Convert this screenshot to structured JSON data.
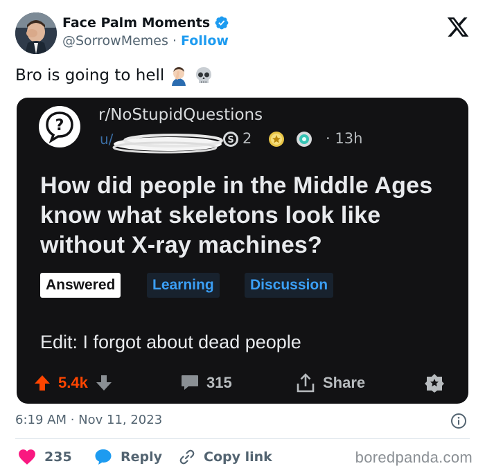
{
  "tweet": {
    "author_name": "Face Palm Moments",
    "author_handle": "@SorrowMemes",
    "separator": " · ",
    "follow_label": "Follow",
    "text": "Bro is going to hell",
    "emojis": [
      "man-facepalming-emoji",
      "skull-emoji"
    ],
    "timestamp": "6:19 AM · Nov 11, 2023",
    "likes": "235",
    "reply_label": "Reply",
    "copy_link_label": "Copy link"
  },
  "embedded_post": {
    "subreddit": "r/NoStupidQuestions",
    "award_count": "2",
    "age": "· 13h",
    "title": "How did people in the Middle Ages know what skeletons look like without X-ray machines?",
    "flairs": [
      "Answered",
      "Learning",
      "Discussion"
    ],
    "edit_text": "Edit: I forgot about dead people",
    "upvotes": "5.4k",
    "comments": "315",
    "share_label": "Share"
  },
  "watermark": "boredpanda.com",
  "colors": {
    "brand_blue": "#1d9bf0",
    "like_red": "#f91880",
    "reddit_upvote": "#ff4500",
    "embed_bg": "#121214"
  },
  "icons": [
    "verified-badge-icon",
    "x-logo-icon",
    "question-bubble-icon",
    "silver-award-icon",
    "gold-award-icon",
    "platinum-award-icon",
    "upvote-arrow-icon",
    "downvote-arrow-icon",
    "comment-icon",
    "share-icon",
    "award-icon",
    "info-icon",
    "heart-icon",
    "reply-bubble-icon",
    "link-icon"
  ]
}
